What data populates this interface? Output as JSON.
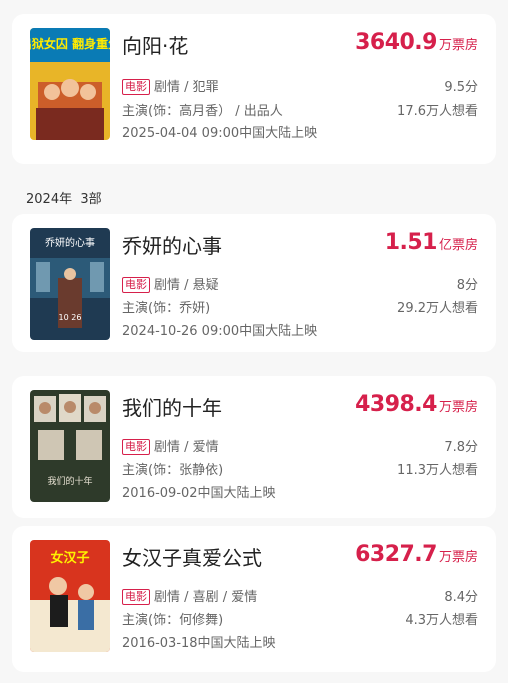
{
  "movies_top": [
    {
      "title": "向阳·花",
      "box_value": "3640.9",
      "box_unit": "万票房",
      "type_tag": "电影",
      "genres": "剧情 / 犯罪",
      "cast": "主演(饰：高月香） / 出品人",
      "release": "2025-04-04 09:00中国大陆上映",
      "score": "9.5分",
      "want": "17.6万人想看",
      "poster_text": "出狱女囚 翻身重生",
      "poster_color": "#f0b400"
    }
  ],
  "section": {
    "year": "2024年",
    "count": "3部"
  },
  "movies": [
    {
      "title": "乔妍的心事",
      "box_value": "1.51",
      "box_unit": "亿票房",
      "type_tag": "电影",
      "genres": "剧情 / 悬疑",
      "cast": "主演(饰：乔妍)",
      "release": "2024-10-26 09:00中国大陆上映",
      "score": "8分",
      "want": "29.2万人想看",
      "poster_text": "乔妍的心事",
      "poster_date": "10 26",
      "poster_color": "#1f3a52"
    },
    {
      "title": "我们的十年",
      "box_value": "4398.4",
      "box_unit": "万票房",
      "type_tag": "电影",
      "genres": "剧情 / 爱情",
      "cast": "主演(饰：张静依)",
      "release": "2016-09-02中国大陆上映",
      "score": "7.8分",
      "want": "11.3万人想看",
      "poster_text": "我们的十年",
      "poster_color": "#2e3a2a"
    },
    {
      "title": "女汉子真爱公式",
      "box_value": "6327.7",
      "box_unit": "万票房",
      "type_tag": "电影",
      "genres": "剧情 / 喜剧 / 爱情",
      "cast": "主演(饰：何修舞)",
      "release": "2016-03-18中国大陆上映",
      "score": "8.4分",
      "want": "4.3万人想看",
      "poster_text": "女汉子",
      "poster_color": "#d8341e"
    }
  ]
}
